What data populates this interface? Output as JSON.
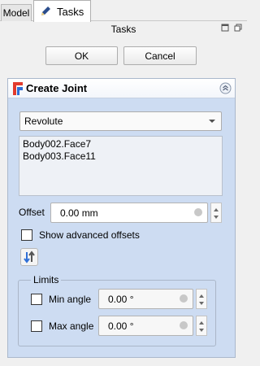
{
  "tabs": {
    "model": "Model",
    "tasks": "Tasks"
  },
  "panel_title": "Tasks",
  "buttons": {
    "ok": "OK",
    "cancel": "Cancel"
  },
  "joint_panel": {
    "title": "Create Joint",
    "joint_type": "Revolute",
    "selected": [
      "Body002.Face7",
      "Body003.Face11"
    ],
    "offset": {
      "label": "Offset",
      "value": "0.00 mm"
    },
    "advanced": {
      "label": "Show advanced offsets",
      "checked": false
    },
    "limits": {
      "title": "Limits",
      "min": {
        "label": "Min angle",
        "value": "0.00 °",
        "checked": false
      },
      "max": {
        "label": "Max angle",
        "value": "0.00 °",
        "checked": false
      }
    }
  },
  "icons": {
    "tasks": "pencil-icon",
    "joint": "assembly-joint-icon",
    "collapse": "collapse-up-icon",
    "reverse": "reverse-direction-icon"
  },
  "colors": {
    "panel_bg": "#cddcf2",
    "accent_red": "#e23b2e",
    "accent_blue": "#2f6fd6"
  }
}
